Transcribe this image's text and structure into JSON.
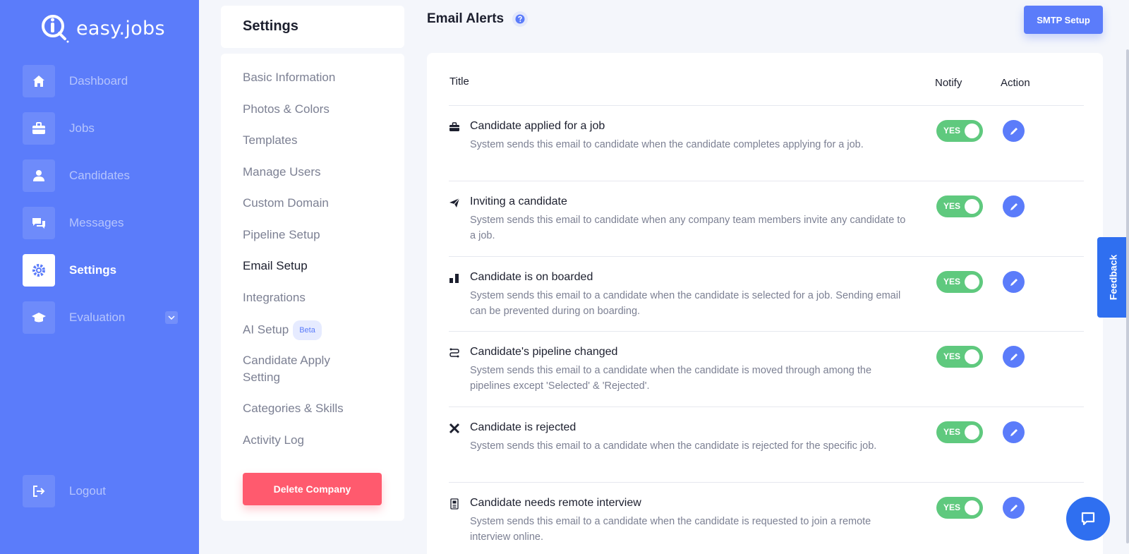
{
  "brand": {
    "name": "easy.jobs"
  },
  "sidebar": {
    "items": [
      {
        "label": "Dashboard",
        "icon": "home-icon"
      },
      {
        "label": "Jobs",
        "icon": "briefcase-icon"
      },
      {
        "label": "Candidates",
        "icon": "user-icon"
      },
      {
        "label": "Messages",
        "icon": "chat-icon"
      },
      {
        "label": "Settings",
        "icon": "gear-icon",
        "active": true
      },
      {
        "label": "Evaluation",
        "icon": "graduation-cap-icon"
      }
    ],
    "logout": "Logout"
  },
  "settings": {
    "title": "Settings",
    "menu": [
      "Basic Information",
      "Photos & Colors",
      "Templates",
      "Manage Users",
      "Custom Domain",
      "Pipeline Setup",
      "Email Setup",
      "Integrations",
      "AI Setup",
      "Candidate Apply",
      "Setting",
      "Categories & Skills",
      "Activity Log"
    ],
    "beta_badge": "Beta",
    "delete_label": "Delete Company"
  },
  "main": {
    "title": "Email Alerts",
    "smtp_label": "SMTP Setup",
    "columns": {
      "title": "Title",
      "notify": "Notify",
      "action": "Action"
    },
    "toggle_label": "YES",
    "alerts": [
      {
        "title": "Candidate applied for a job",
        "desc": "System sends this email to candidate when the candidate completes applying for a job.",
        "notify": true,
        "icon": "briefcase-icon"
      },
      {
        "title": "Inviting a candidate",
        "desc": "System sends this email to candidate when any company team members invite any candidate to a job.",
        "notify": true,
        "icon": "paper-plane-icon"
      },
      {
        "title": "Candidate is on boarded",
        "desc": "System sends this email to a candidate when the candidate is selected for a job. Sending email can be prevented during on boarding.",
        "notify": true,
        "icon": "onboard-icon"
      },
      {
        "title": "Candidate's pipeline changed",
        "desc": "System sends this email to a candidate when the candidate is moved through among the pipelines except 'Selected' & 'Rejected'.",
        "notify": true,
        "icon": "pipeline-icon"
      },
      {
        "title": "Candidate is rejected",
        "desc": "System sends this email to a candidate when the candidate is rejected for the specific job.",
        "notify": true,
        "icon": "x-icon"
      },
      {
        "title": "Candidate needs remote interview",
        "desc": "System sends this email to a candidate when the candidate is requested to join a remote interview online.",
        "notify": true,
        "icon": "interview-icon"
      }
    ]
  },
  "feedback_label": "Feedback",
  "colors": {
    "primary": "#5b7cfa",
    "success": "#5fc97e",
    "danger": "#ff5a6e"
  }
}
